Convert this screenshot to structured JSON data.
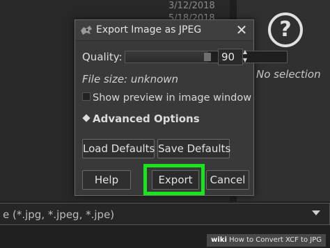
{
  "background": {
    "date_text": "3/12/2018\n5/18/2018",
    "no_selection": "No selection",
    "filter_text": "e (*.jpg, *.jpeg, *.jpe)"
  },
  "dialog": {
    "title": "Export Image as JPEG",
    "quality_label": "Quality:",
    "quality_value": "90",
    "quality_level": 0.9,
    "file_size": "File size: unknown",
    "show_preview_label": "Show preview in image window",
    "show_preview_checked": false,
    "advanced_options_label": "Advanced Options",
    "load_defaults": "Load Defaults",
    "save_defaults": "Save Defaults",
    "help": "Help",
    "export": "Export",
    "cancel": "Cancel"
  },
  "highlight_color": "#19e51f",
  "watermark": {
    "brand": "wiki",
    "text": "How to Convert XCF to JPG"
  }
}
